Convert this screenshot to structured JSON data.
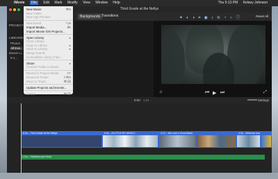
{
  "menubar": {
    "items": [
      "iMovie",
      "File",
      "Edit",
      "Mark",
      "Modify",
      "View",
      "Window",
      "Help"
    ],
    "time": "Thu 5:13 PM",
    "user": "Kelsey Johnson"
  },
  "window": {
    "title": "Third Grade at the Nellys",
    "tabs": [
      "Backgrounds",
      "Transitions"
    ],
    "reset_all": "Reset All"
  },
  "sidebar": {
    "project_label": "PROJECT M",
    "library_label": "LIBRARIES",
    "items": [
      "Photos",
      "All Eve...",
      "iMovie Li...",
      "9-1..."
    ]
  },
  "timeline": {
    "timecode": "0:00",
    "duration": "1:01",
    "settings": "Settings",
    "clips": [
      {
        "label": "6.0s – Third Grade at the Nellys"
      },
      {
        "label": "6.0s – A LITTLE BIT ABOUT..."
      },
      {
        "label": "4.7s – We Love a Good Band"
      },
      {
        "label": ""
      },
      {
        "label": "4.3s – What we love ab..."
      },
      {
        "label": ""
      }
    ],
    "audio_label": "1.0m – Kaleidoscope Heart"
  },
  "file_menu": {
    "items": [
      {
        "label": "New Movie",
        "shortcut": "⌘N",
        "disabled": false
      },
      {
        "label": "New Trailer",
        "shortcut": "",
        "disabled": true
      },
      {
        "label": "New App Preview",
        "shortcut": "",
        "disabled": true
      },
      {
        "label": "New Event",
        "shortcut": "⌥N",
        "disabled": true
      },
      {
        "label": "Import Media...",
        "shortcut": "⌘I",
        "disabled": false
      },
      {
        "label": "Import iMovie iOS Projects...",
        "shortcut": "",
        "disabled": false
      },
      {
        "label": "Open Library",
        "shortcut": "▸",
        "disabled": false
      },
      {
        "label": "Close Library",
        "shortcut": "",
        "disabled": true
      },
      {
        "label": "Copy to Library",
        "shortcut": "▸",
        "disabled": true
      },
      {
        "label": "Move to Library",
        "shortcut": "▸",
        "disabled": true
      },
      {
        "label": "Merge Events",
        "shortcut": "",
        "disabled": true
      },
      {
        "label": "Consolidate Library Files...",
        "shortcut": "",
        "disabled": true
      },
      {
        "label": "Share",
        "shortcut": "▸",
        "disabled": false
      },
      {
        "label": "Convert Trailer to Movie",
        "shortcut": "",
        "disabled": true
      },
      {
        "label": "Reveal in Project Media",
        "shortcut": "⇧F",
        "disabled": true
      },
      {
        "label": "Reveal in Finder",
        "shortcut": "⇧⌘R",
        "disabled": true
      },
      {
        "label": "Move to Trash",
        "shortcut": "⌘⌫",
        "disabled": true
      },
      {
        "label": "Update Projects and Events...",
        "shortcut": "",
        "disabled": false
      },
      {
        "label": "Delete",
        "shortcut": "⌘⌫",
        "disabled": true
      }
    ]
  },
  "colors": {
    "accent": "#2f6fd6",
    "clip_border": "#3a6ad0",
    "audio": "#2a8e4c"
  }
}
